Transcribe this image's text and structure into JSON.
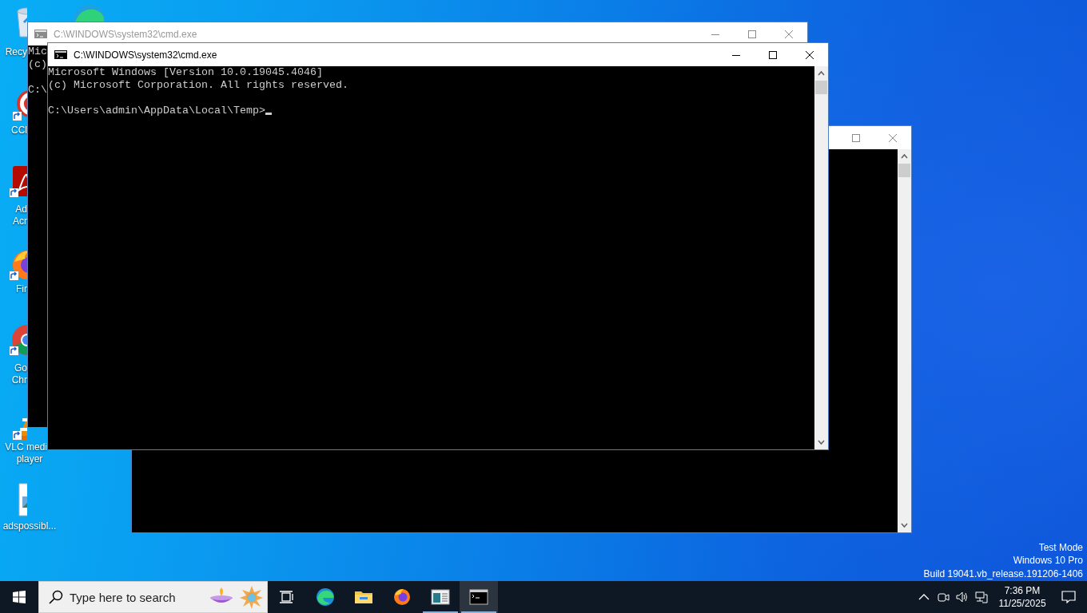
{
  "desktop": {
    "icons": [
      {
        "kind": "recycle-bin",
        "lines": [
          "Recy"
        ]
      },
      {
        "kind": "edge"
      },
      {
        "kind": "ccleaner",
        "lines": [
          "CCl"
        ]
      },
      {
        "kind": "acrobat",
        "lines": [
          "Ad",
          "Acr"
        ]
      },
      {
        "kind": "firefox",
        "lines": [
          "Fir"
        ]
      },
      {
        "kind": "chrome",
        "lines": [
          "Go",
          "Chr"
        ]
      },
      {
        "kind": "vlc",
        "lines": [
          "VLC medi",
          "player"
        ]
      },
      {
        "kind": "image-file",
        "lines": [
          "adspossibl..."
        ]
      }
    ]
  },
  "windows": [
    {
      "active": false,
      "controls": [
        {
          "kind": "maximize"
        },
        {
          "kind": "close"
        }
      ],
      "scrollbar": true
    },
    {
      "title": "C:\\WINDOWS\\system32\\cmd.exe",
      "active": false,
      "controls": [
        {
          "kind": "minimize"
        },
        {
          "kind": "maximize"
        },
        {
          "kind": "close"
        }
      ],
      "lines": [
        "Mic",
        "(c)"
      ],
      "prompt": "C:\\"
    },
    {
      "title": "C:\\WINDOWS\\system32\\cmd.exe",
      "active": true,
      "controls": [
        {
          "kind": "minimize"
        },
        {
          "kind": "maximize"
        },
        {
          "kind": "close"
        }
      ],
      "scrollbar": true,
      "lines": [
        "Microsoft Windows [Version 10.0.19045.4046]",
        "(c) Microsoft Corporation. All rights reserved."
      ],
      "prompt": "C:\\Users\\admin\\AppData\\Local\\Temp>",
      "cursor": true
    }
  ],
  "system_info": [
    "Test Mode",
    "Windows 10 Pro",
    "Build 19041.vb_release.191206-1406"
  ],
  "taskbar": {
    "search": {
      "placeholder": "Type here to search"
    },
    "apps": [
      {
        "kind": "edge",
        "running": false,
        "selected": false
      },
      {
        "kind": "explorer",
        "running": false,
        "selected": false
      },
      {
        "kind": "firefox",
        "running": false,
        "selected": false
      },
      {
        "kind": "app-window",
        "running": true,
        "selected": false
      },
      {
        "kind": "console",
        "running": true,
        "selected": true
      }
    ],
    "clock": {
      "time": "7:36 PM",
      "date": "11/25/2025"
    }
  }
}
